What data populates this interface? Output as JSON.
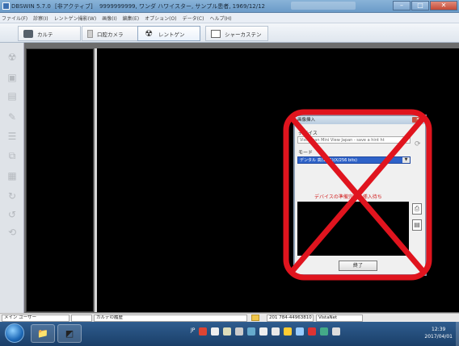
{
  "window": {
    "title": "DBSWIN 5.7.0",
    "subtitle": "[非アクティブ]",
    "title_patient": "9999999999, ワンダ ハワイスター, サンプル患者, 1969/12/12"
  },
  "menu": [
    "ファイル(F)",
    "診察(I)",
    "レントゲン撮影(W)",
    "画像(I)",
    "編集(E)",
    "オプション(O)",
    "データ(C)",
    "ヘルプ(H)"
  ],
  "tabs": [
    {
      "label": "カルテ",
      "icon": "chart-record-icon"
    },
    {
      "label": "口腔カメラ",
      "icon": "intraoral-camera-icon"
    },
    {
      "label": "レントゲン",
      "icon": "radiation-icon",
      "active": true
    },
    {
      "label": "シャーカステン",
      "icon": "light-box-icon"
    }
  ],
  "dialog": {
    "title": "画像挿入",
    "device_label": "デバイス",
    "device_value": "VistaScan Mini View Japan - save a hint ht",
    "mode_label": "モード",
    "mode_value": "デンタル 高(1/15)(X/256 bits)",
    "status": "デバイスの準備完了 - 挿入待ち",
    "end_button": "終了"
  },
  "statusbar": {
    "user": "メイン ユーザー",
    "history": "カルテの履歴",
    "device_id": "201 784-44963810",
    "device_name": "VistaNet"
  },
  "taskbar": {
    "ime": "JP",
    "time": "12:39",
    "date": "2017/04/01"
  },
  "colors": {
    "xmark": "#e0141e",
    "status_text": "#d21f1f",
    "mode_selection": "#2e62c8"
  }
}
